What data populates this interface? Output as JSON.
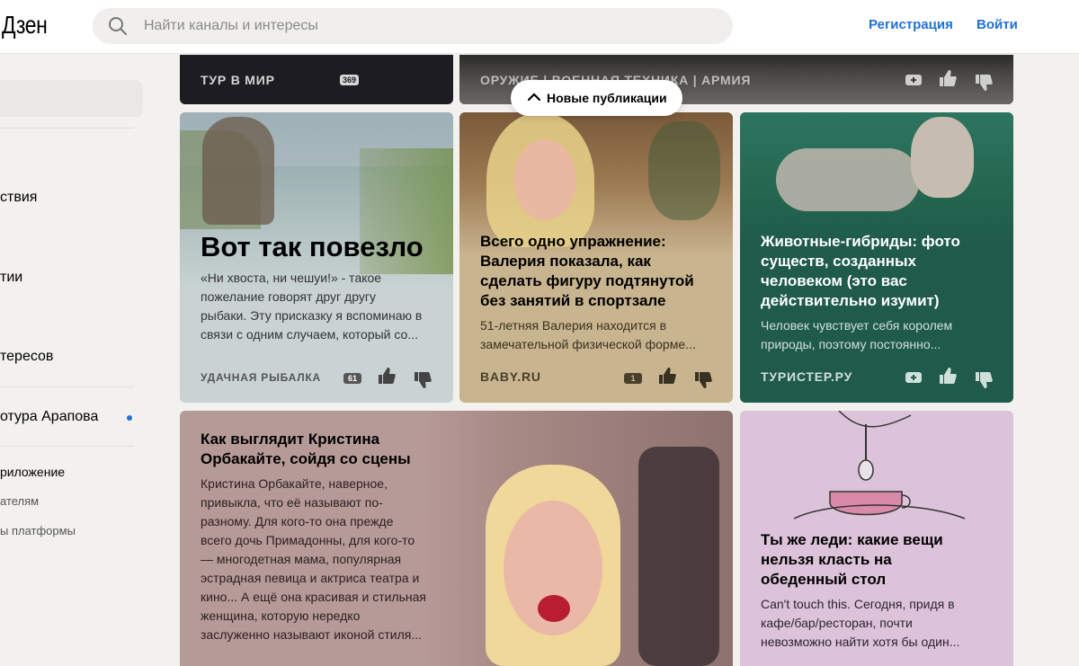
{
  "header": {
    "logo": "Дзен",
    "search_placeholder": "Найти каналы и интересы",
    "register_label": "Регистрация",
    "login_label": "Войти"
  },
  "sidebar": {
    "items": [
      {
        "label": "ствия"
      },
      {
        "label": "тии"
      },
      {
        "label": "тересов"
      },
      {
        "label": "отура Арапова"
      }
    ],
    "footer": [
      {
        "label": "риложение"
      },
      {
        "label": "ателям"
      },
      {
        "label": "ы платформы"
      }
    ]
  },
  "new_publications_label": "Новые публикации",
  "top_cards": [
    {
      "source": "ТУР В МИР",
      "count": "369"
    },
    {
      "source": "ОРУЖИЕ | ВОЕННАЯ ТЕХНИКА | АРМИЯ"
    }
  ],
  "cards": [
    {
      "title": "Вот так повезло",
      "description": "«Ни хвоста, ни чешуи!» - такое пожелание говорят друг другу рыбаки. Эту присказку я вспоминаю в связи с одним случаем, который со...",
      "desc_lines": [
        "«Ни хвоста, ни чешуи!» - такое",
        "пожелание говорят друг другу",
        "рыбаки. Эту присказку я вспоминаю в",
        "связи с одним случаем, который со..."
      ],
      "source": "УДАЧНАЯ РЫБАЛКА",
      "count": "61"
    },
    {
      "title": "Всего одно упражнение: Валерия показала, как сделать фигуру подтянутой без занятий в спортзале",
      "title_lines": [
        "Всего одно упражнение:",
        "Валерия показала, как",
        "сделать фигуру подтянутой",
        "без занятий в спортзале"
      ],
      "description": "51-летняя Валерия находится в замечательной физической форме...",
      "desc_lines": [
        "51-летняя Валерия находится в",
        "замечательной физической форме..."
      ],
      "source": "BABY.RU",
      "count": "1"
    },
    {
      "title": "Животные-гибриды: фото существ, созданных человеком (это вас действительно изумит)",
      "title_lines": [
        "Животные-гибриды: фото",
        "существ, созданных",
        "человеком (это вас",
        "действительно изумит)"
      ],
      "description": "Человек чувствует себя королем природы, поэтому постоянно...",
      "desc_lines": [
        "Человек чувствует себя королем",
        "природы, поэтому постоянно..."
      ],
      "source": "ТУРИСТЕР.РУ"
    },
    {
      "title": "Как выглядит Кристина Орбакайте, сойдя со сцены",
      "title_lines": [
        "Как выглядит Кристина",
        "Орбакайте, сойдя со сцены"
      ],
      "description": "Кристина Орбакайте, наверное, привыкла, что её называют по-разному. Для кого-то она прежде всего дочь Примадонны, для кого-то — многодетная мама, популярная эстрадная певица и актриса театра и кино... А ещё она красивая и стильная женщина, которую нередко заслуженно называют иконой стиля...",
      "desc_lines": [
        "Кристина Орбакайте, наверное,",
        "привыкла, что её называют по-",
        "разному. Для кого-то она прежде",
        "всего дочь Примадонны, для кого-то",
        "— многодетная мама, популярная",
        "эстрадная певица и актриса театра и",
        "кино... А ещё она красивая и стильная",
        "женщина, которую нередко",
        "заслуженно называют иконой стиля..."
      ]
    },
    {
      "title": "Ты же леди: какие вещи нельзя класть на обеденный стол",
      "title_lines": [
        "Ты же леди: какие вещи",
        "нельзя класть на",
        "обеденный стол"
      ],
      "description": "Can't touch this. Сегодня, придя в кафе/бар/ресторан, почти невозможно найти хотя бы один...",
      "desc_lines": [
        "Can't touch this. Сегодня, придя в",
        "кафе/бар/ресторан, почти",
        "невозможно найти хотя бы один..."
      ]
    }
  ],
  "colors": {
    "link_blue": "#2271d6",
    "card_fishing": "#c9d3d3",
    "card_baby": "#c8b48f",
    "card_zebra": "#1f5a4a",
    "card_orbakaite": "#b69a98",
    "card_lady": "#dcc3da",
    "dark_card": "#1c1c22"
  }
}
